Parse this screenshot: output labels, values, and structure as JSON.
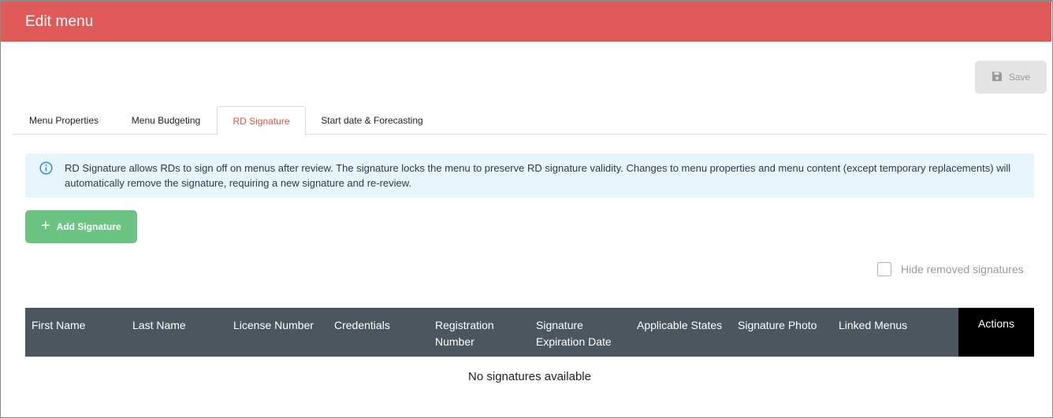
{
  "header": {
    "title": "Edit menu"
  },
  "toolbar": {
    "save_label": "Save"
  },
  "tabs": [
    {
      "label": "Menu Properties"
    },
    {
      "label": "Menu Budgeting"
    },
    {
      "label": "RD Signature"
    },
    {
      "label": "Start date & Forecasting"
    }
  ],
  "info": {
    "text": "RD Signature allows RDs to sign off on menus after review. The signature locks the menu to preserve RD signature validity. Changes to menu properties and menu content (except temporary replacements) will automatically remove the signature, requiring a new signature and re-review."
  },
  "add_signature": {
    "label": "Add Signature"
  },
  "filter": {
    "hide_removed_label": "Hide removed signatures"
  },
  "table": {
    "columns": [
      "First Name",
      "Last Name",
      "License Number",
      "Credentials",
      "Registration Number",
      "Signature Expiration Date",
      "Applicable States",
      "Signature Photo",
      "Linked Menus"
    ],
    "actions_label": "Actions",
    "empty_text": "No signatures available"
  },
  "colors": {
    "header": "#e05a5a",
    "active_tab": "#d9534f",
    "add_button": "#6cc483",
    "table_header": "#4b565e",
    "info_bg": "#e6f6fc"
  }
}
